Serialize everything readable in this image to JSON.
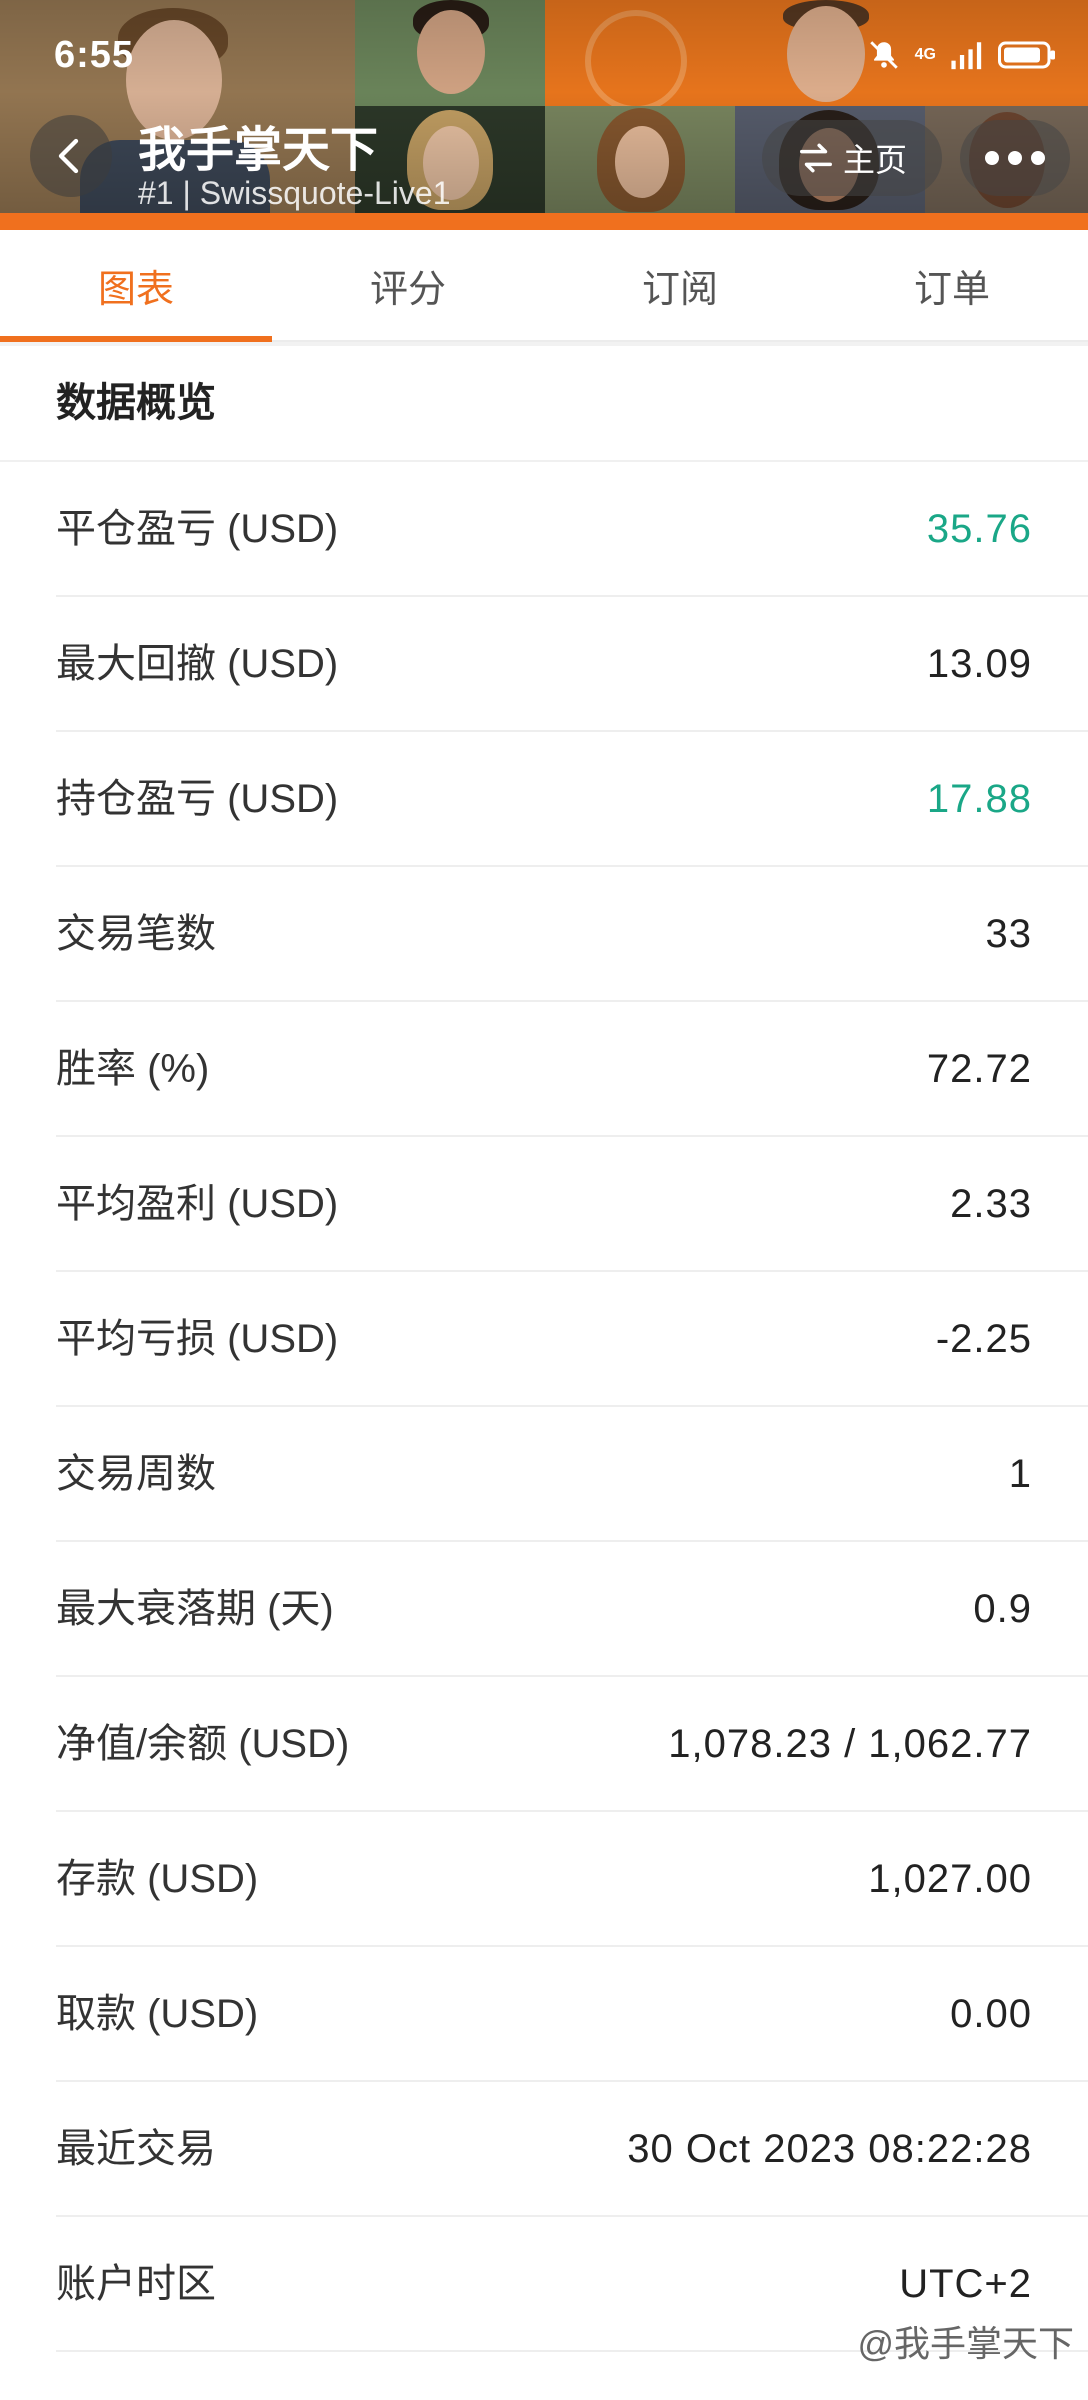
{
  "status_bar": {
    "time": "6:55",
    "network": "4G",
    "icons": [
      "bell-off-icon",
      "signal-icon",
      "battery-icon"
    ]
  },
  "header": {
    "title": "我手掌天下",
    "subtitle": "#1 | Swissquote-Live1",
    "home_label": "主页",
    "accent_color": "#f0701e"
  },
  "tabs": [
    {
      "label": "图表",
      "active": true
    },
    {
      "label": "评分",
      "active": false
    },
    {
      "label": "订阅",
      "active": false
    },
    {
      "label": "订单",
      "active": false
    }
  ],
  "overview": {
    "title": "数据概览",
    "rows": [
      {
        "label": "平仓盈亏 (USD)",
        "value": "35.76",
        "color": "#1aa787"
      },
      {
        "label": "最大回撤 (USD)",
        "value": "13.09"
      },
      {
        "label": "持仓盈亏 (USD)",
        "value": "17.88",
        "color": "#1aa787"
      },
      {
        "label": "交易笔数",
        "value": "33"
      },
      {
        "label": "胜率 (%)",
        "value": "72.72"
      },
      {
        "label": "平均盈利 (USD)",
        "value": "2.33"
      },
      {
        "label": "平均亏损 (USD)",
        "value": "-2.25"
      },
      {
        "label": "交易周数",
        "value": "1"
      },
      {
        "label": "最大衰落期 (天)",
        "value": "0.9"
      },
      {
        "label": "净值/余额 (USD)",
        "value": "1,078.23 / 1,062.77"
      },
      {
        "label": "存款 (USD)",
        "value": "1,027.00"
      },
      {
        "label": "取款 (USD)",
        "value": "0.00"
      },
      {
        "label": "最近交易",
        "value": "30 Oct 2023 08:22:28"
      },
      {
        "label": "账户时区",
        "value": "UTC+2"
      }
    ]
  },
  "watermark": "@我手掌天下"
}
